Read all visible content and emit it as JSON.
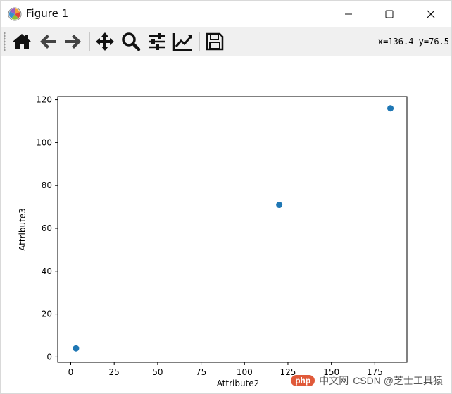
{
  "window": {
    "title": "Figure 1"
  },
  "toolbar": {
    "coordinates": "x=136.4 y=76.5",
    "tools": [
      "home",
      "back",
      "forward",
      "pan",
      "zoom",
      "configure-subplots",
      "edit-axis",
      "save"
    ]
  },
  "watermark": {
    "site": "php",
    "site_cn": "中文网",
    "author": "CSDN @芝士工具猿"
  },
  "colors": {
    "marker": "#1f77b4",
    "toolbar_bg": "#f0f0f0"
  },
  "chart_data": {
    "type": "scatter",
    "title": "",
    "xlabel": "Attribute2",
    "ylabel": "Attribute3",
    "x": [
      3,
      120,
      184
    ],
    "y": [
      4,
      71,
      116
    ],
    "xlim": [
      -7.5,
      193.5
    ],
    "ylim": [
      -2.5,
      121.5
    ],
    "xticks": [
      0,
      25,
      50,
      75,
      100,
      125,
      150,
      175
    ],
    "yticks": [
      0,
      20,
      40,
      60,
      80,
      100,
      120
    ],
    "grid": false
  }
}
